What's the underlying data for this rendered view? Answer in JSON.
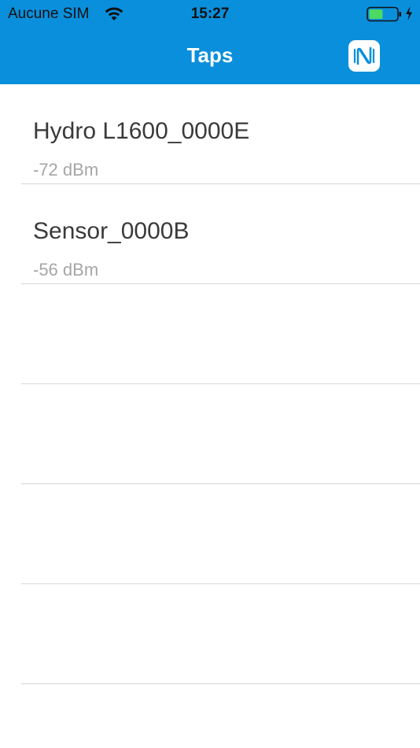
{
  "status_bar": {
    "carrier": "Aucune SIM",
    "time": "15:27",
    "icons": [
      "wifi-icon",
      "battery-icon",
      "charging-bolt-icon"
    ],
    "battery_color": "#4cd964"
  },
  "nav_bar": {
    "title": "Taps",
    "right_icon": "nfc-icon",
    "background_color": "#0a8fdc"
  },
  "devices": [
    {
      "name": "Hydro L1600_0000E",
      "signal": "-72 dBm"
    },
    {
      "name": "Sensor_0000B",
      "signal": "-56 dBm"
    }
  ]
}
